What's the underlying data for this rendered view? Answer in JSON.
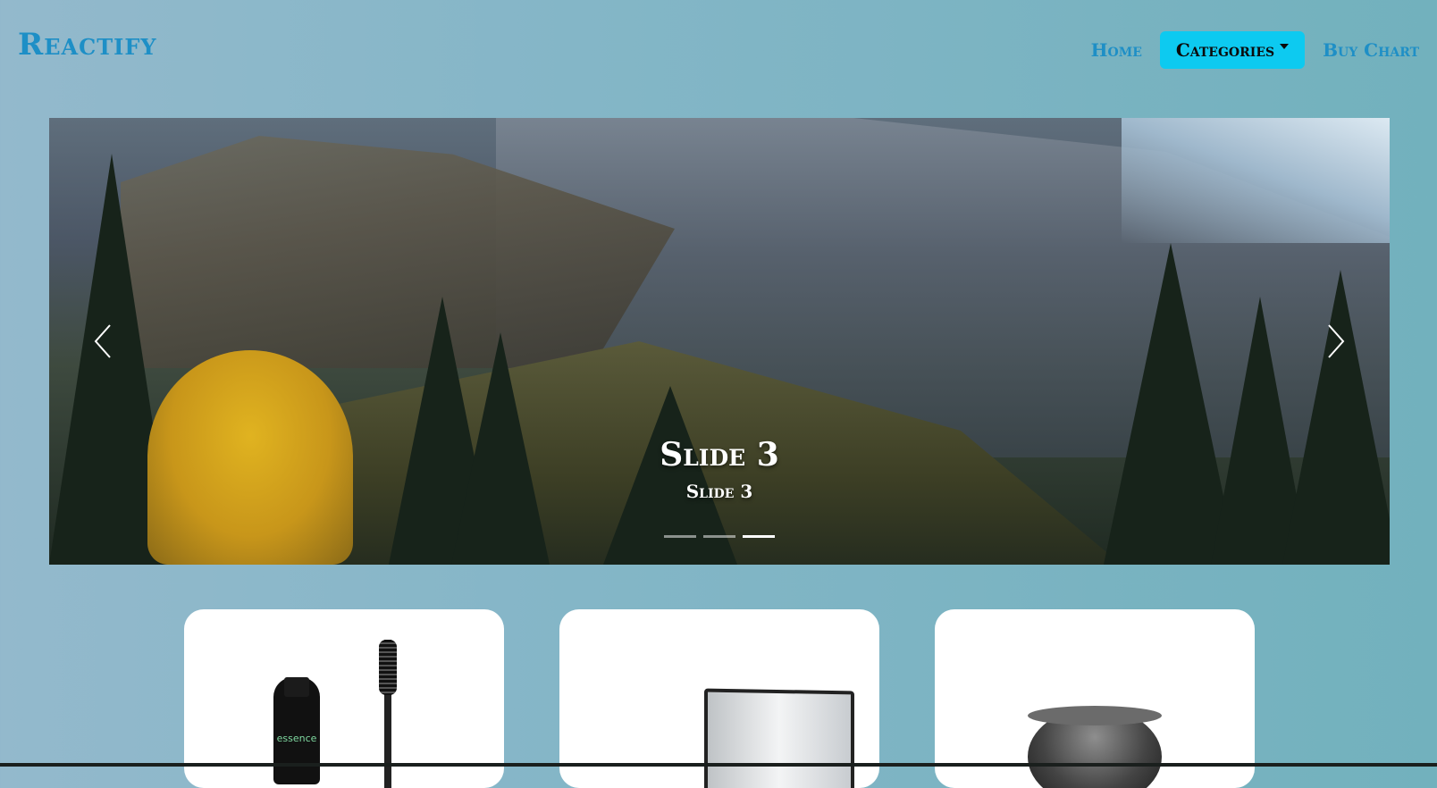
{
  "navbar": {
    "brand": "Reactify",
    "links": [
      {
        "label": "Home"
      },
      {
        "label": "Categories",
        "dropdown": true
      },
      {
        "label": "Buy Chart"
      }
    ],
    "accent_color": "#0dcaf0",
    "link_color": "#1e8fc6"
  },
  "carousel": {
    "active_index": 2,
    "slide_count": 3,
    "caption_title": "Slide 3",
    "caption_text": "Slide 3",
    "prev_icon": "chevron-left-icon",
    "next_icon": "chevron-right-icon"
  },
  "products": [
    {
      "image": "mascara-image",
      "brand_text": "essence"
    },
    {
      "image": "mirror-image"
    },
    {
      "image": "compact-image"
    }
  ]
}
